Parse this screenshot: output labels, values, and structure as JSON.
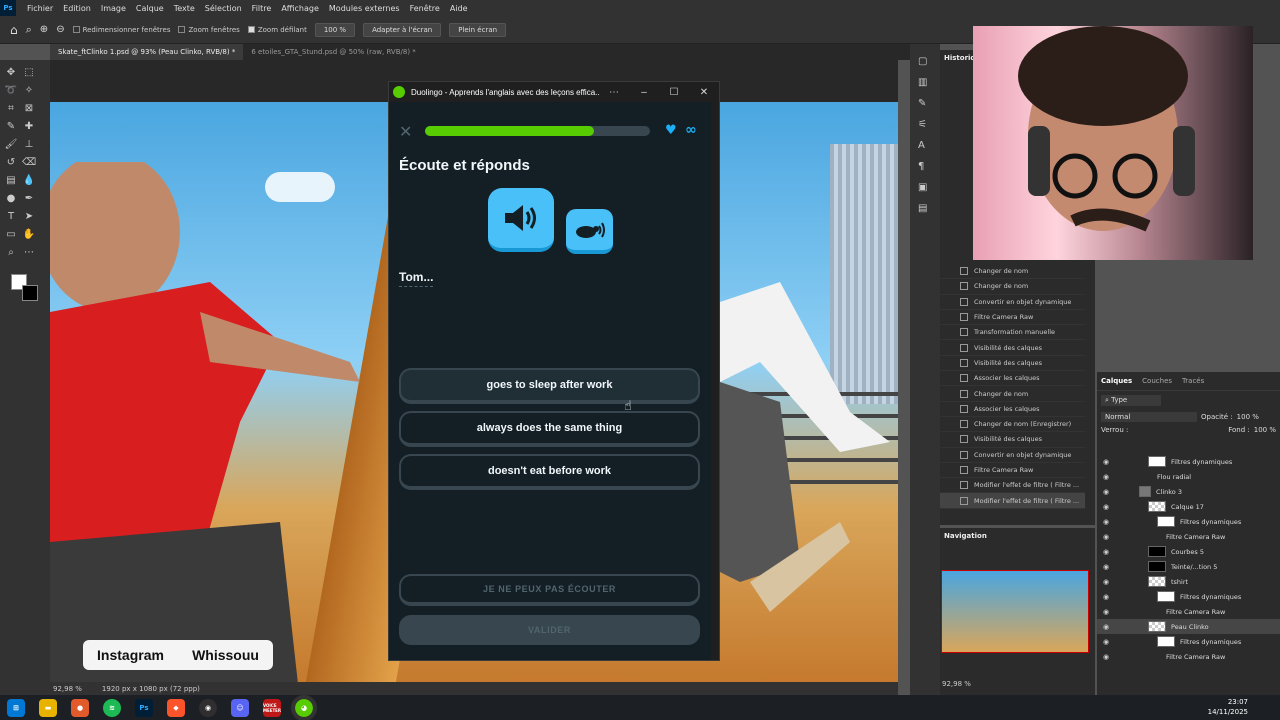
{
  "menu": {
    "items": [
      "Fichier",
      "Edition",
      "Image",
      "Calque",
      "Texte",
      "Sélection",
      "Filtre",
      "Affichage",
      "Modules externes",
      "Fenêtre",
      "Aide"
    ]
  },
  "options": {
    "resize_windows": "Redimensionner fenêtres",
    "zoom_windows": "Zoom fenêtres",
    "scrubby_zoom": "Zoom défilant",
    "zoom_value": "100 %",
    "fit_screen": "Adapter à l'écran",
    "full_screen": "Plein écran"
  },
  "tabs": [
    {
      "label": "Skate_ftClinko 1.psd @ 93% (Peau Clinko, RVB/8) *"
    },
    {
      "label": "6 etoiles_GTA_Stund.psd @ 50% (raw, RVB/8) *"
    }
  ],
  "overlay": {
    "instagram": "Instagram",
    "handle": "Whissouu"
  },
  "status": {
    "zoom": "92,98 %",
    "dims": "1920 px x 1080 px (72 ppp)"
  },
  "history": {
    "title": "Historique",
    "items": [
      "Changer de nom",
      "Changer de nom",
      "Convertir en objet dynamique",
      "Filtre Camera Raw",
      "Transformation manuelle",
      "Visibilité des calques",
      "Visibilité des calques",
      "Associer les calques",
      "Changer de nom",
      "Associer les calques",
      "Changer de nom (Enregistrer)",
      "Visibilité des calques",
      "Convertir en objet dynamique",
      "Filtre Camera Raw",
      "Modifier l'effet de filtre ( Filtre ...",
      "Modifier l'effet de filtre ( Filtre ..."
    ]
  },
  "navigator": {
    "title": "Navigation",
    "zoom": "92,98 %"
  },
  "layers": {
    "tabs": [
      "Calques",
      "Couches",
      "Tracés"
    ],
    "kind": "Type",
    "blend": "Normal",
    "opacity_label": "Opacité :",
    "opacity": "100 %",
    "lock_label": "Verrou :",
    "fill_label": "Fond :",
    "fill": "100 %",
    "rows": [
      {
        "name": "Filtres dynamiques",
        "indent": 3,
        "thumb": "white"
      },
      {
        "name": "Flou radial",
        "indent": 4,
        "thumb": "none"
      },
      {
        "name": "Clinko 3",
        "indent": 2,
        "thumb": "folder"
      },
      {
        "name": "Calque 17",
        "indent": 3,
        "thumb": "check"
      },
      {
        "name": "Filtres dynamiques",
        "indent": 4,
        "thumb": "white"
      },
      {
        "name": "Filtre Camera Raw",
        "indent": 5,
        "thumb": "none"
      },
      {
        "name": "Courbes 5",
        "indent": 3,
        "thumb": "black"
      },
      {
        "name": "Teinte/...tion 5",
        "indent": 3,
        "thumb": "black"
      },
      {
        "name": "tshirt",
        "indent": 3,
        "thumb": "check"
      },
      {
        "name": "Filtres dynamiques",
        "indent": 4,
        "thumb": "white"
      },
      {
        "name": "Filtre Camera Raw",
        "indent": 5,
        "thumb": "none"
      },
      {
        "name": "Peau Clinko",
        "indent": 3,
        "thumb": "check"
      },
      {
        "name": "Filtres dynamiques",
        "indent": 4,
        "thumb": "white"
      },
      {
        "name": "Filtre Camera Raw",
        "indent": 5,
        "thumb": "none"
      }
    ]
  },
  "duo": {
    "window_title": "Duolingo - Apprends l'anglais avec des leçons effica...",
    "progress": 0.75,
    "heading": "Écoute et réponds",
    "prompt": "Tom...",
    "choices": [
      "goes to sleep after work",
      "always does the same thing",
      "doesn't eat before work"
    ],
    "cant_listen": "JE NE PEUX PAS ÉCOUTER",
    "validate": "VALIDER",
    "colors": {
      "bg": "#131f24",
      "accent": "#49c0f8",
      "progress": "#58cc02"
    }
  },
  "clock": {
    "time": "23:07",
    "date": "14/11/2025"
  },
  "taskbar": {
    "voice_label": "VOICE\nMEETER"
  }
}
